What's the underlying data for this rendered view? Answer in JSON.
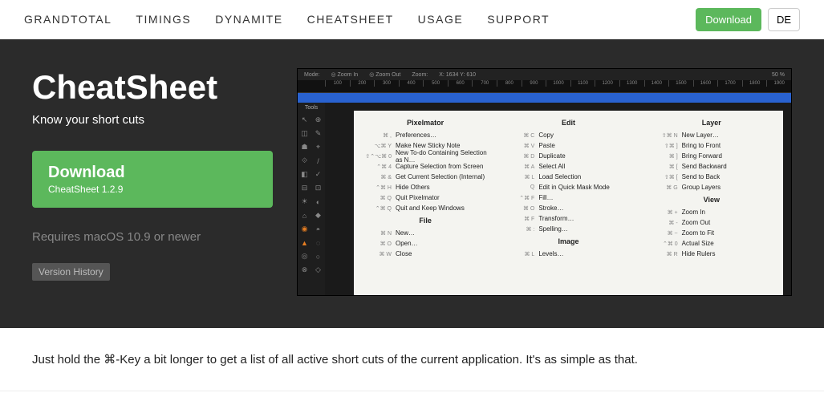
{
  "nav": {
    "items": [
      "GRANDTOTAL",
      "TIMINGS",
      "DYNAMITE",
      "CHEATSHEET",
      "USAGE",
      "SUPPORT"
    ],
    "download": "Download",
    "lang": "DE"
  },
  "hero": {
    "title": "CheatSheet",
    "subtitle": "Know your short cuts",
    "download_label": "Download",
    "download_version": "CheatSheet 1.2.9",
    "requires": "Requires macOS 10.9 or newer",
    "version_history": "Version History"
  },
  "shot": {
    "top": {
      "mode": "Mode:",
      "zin": "◎ Zoom In",
      "zout": "◎ Zoom Out",
      "zoom": "Zoom:",
      "coords": "X: 1634  Y: 610",
      "pct": "50 %"
    },
    "ruler": [
      "100",
      "200",
      "300",
      "400",
      "500",
      "600",
      "700",
      "800",
      "900",
      "1000",
      "1100",
      "1200",
      "1300",
      "1400",
      "1500",
      "1600",
      "1700",
      "1800",
      "1900"
    ],
    "tools": "Tools",
    "cols": [
      {
        "title": "Pixelmator",
        "rows": [
          {
            "k": "⌘ ,",
            "v": "Preferences…"
          },
          {
            "k": "⌥⌘ Y",
            "v": "Make New Sticky Note"
          },
          {
            "k": "⇧⌃⌥⌘ 0",
            "v": "New To-do Containing Selection as N…"
          },
          {
            "k": "⌃⌘ 4",
            "v": "Capture Selection from Screen"
          },
          {
            "k": "⌘ &",
            "v": "Get Current Selection (Internal)"
          },
          {
            "k": "⌃⌘ H",
            "v": "Hide Others"
          },
          {
            "k": "⌘ Q",
            "v": "Quit Pixelmator"
          },
          {
            "k": "⌃⌘ Q",
            "v": "Quit and Keep Windows"
          }
        ]
      },
      {
        "title": "File",
        "rows": [
          {
            "k": "⌘ N",
            "v": "New…"
          },
          {
            "k": "⌘ O",
            "v": "Open…"
          },
          {
            "k": "⌘ W",
            "v": "Close"
          }
        ]
      },
      {
        "title": "Edit",
        "rows": [
          {
            "k": "⌘ C",
            "v": "Copy"
          },
          {
            "k": "⌘ V",
            "v": "Paste"
          },
          {
            "k": "⌘ D",
            "v": "Duplicate"
          },
          {
            "k": "⌘ A",
            "v": "Select All"
          },
          {
            "k": "⌘ L",
            "v": "Load Selection"
          },
          {
            "k": "Q",
            "v": "Edit in Quick Mask Mode"
          },
          {
            "k": "⌃⌘ F",
            "v": "Fill…"
          },
          {
            "k": "⌘ O",
            "v": "Stroke…"
          },
          {
            "k": "⌘ F",
            "v": "Transform…"
          },
          {
            "k": "⌘ :",
            "v": "Spelling…"
          }
        ]
      },
      {
        "title": "Image",
        "rows": [
          {
            "k": "⌘ L",
            "v": "Levels…"
          }
        ]
      },
      {
        "title": "Layer",
        "rows": [
          {
            "k": "⇧⌘ N",
            "v": "New Layer…"
          },
          {
            "k": "⇧⌘ ]",
            "v": "Bring to Front"
          },
          {
            "k": "⌘ ]",
            "v": "Bring Forward"
          },
          {
            "k": "⌘ [",
            "v": "Send Backward"
          },
          {
            "k": "⇧⌘ [",
            "v": "Send to Back"
          },
          {
            "k": "⌘ G",
            "v": "Group Layers"
          }
        ]
      },
      {
        "title": "View",
        "rows": [
          {
            "k": "⌘ +",
            "v": "Zoom In"
          },
          {
            "k": "⌘ -",
            "v": "Zoom Out"
          },
          {
            "k": "⌘ ~",
            "v": "Zoom to Fit"
          },
          {
            "k": "⌃⌘ 0",
            "v": "Actual Size"
          },
          {
            "k": "⌘ R",
            "v": "Hide Rulers"
          }
        ]
      }
    ]
  },
  "tagline": "Just hold the ⌘-Key a bit longer to get a list of all active short cuts of the current application. It's as simple as that."
}
